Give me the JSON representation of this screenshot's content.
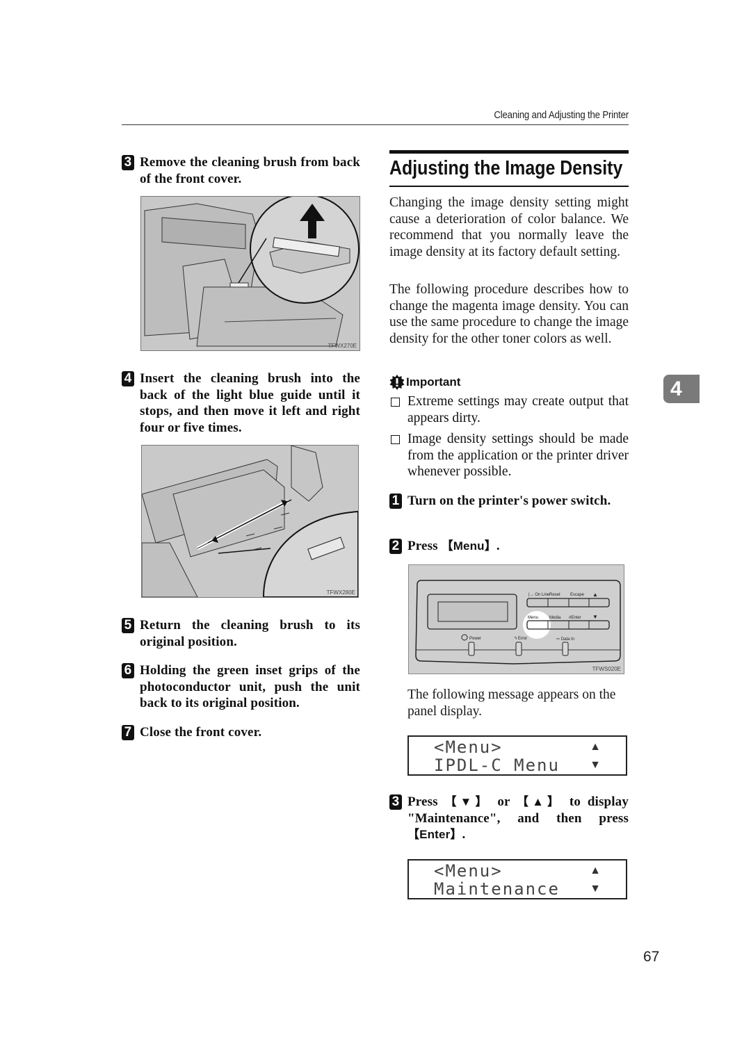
{
  "header": {
    "running_head": "Cleaning and Adjusting the Printer"
  },
  "left_column": {
    "steps": [
      {
        "number": "3",
        "text": "Remove the cleaning brush from back of the front cover."
      },
      {
        "number": "4",
        "text": "Insert the cleaning brush into the back of the light blue guide until it stops, and then move it left and right four or five times."
      },
      {
        "number": "5",
        "text": "Return the cleaning brush to its original position."
      },
      {
        "number": "6",
        "text": "Holding the green inset grips of the photoconductor unit, push the unit back to its original position."
      },
      {
        "number": "7",
        "text": "Close the front cover."
      }
    ],
    "figures": [
      {
        "code": "TFWX270E",
        "description": "printer-front-cover-brush-removal-illustration"
      },
      {
        "code": "TFWX280E",
        "description": "cleaning-brush-insertion-illustration"
      }
    ]
  },
  "right_column": {
    "section_title": "Adjusting the Image Density",
    "intro_paragraphs": [
      "Changing the image density setting might cause a deterioration of color balance. We recommend that you normally leave the image density at its factory default setting.",
      "The following procedure describes how to change the magenta image density. You can use the same procedure to change the image density for the other toner colors as well."
    ],
    "important": {
      "label": "Important",
      "icon": "important-icon",
      "items": [
        "Extreme settings may create output that appears dirty.",
        "Image density settings should be made from the application or the printer driver whenever possible."
      ]
    },
    "steps": [
      {
        "number": "1",
        "text": "Turn on the printer's power switch."
      },
      {
        "number": "2",
        "prefix": "Press ",
        "key": "【Menu】",
        "suffix": "."
      },
      {
        "number": "3",
        "text_a": "Press ",
        "key_a": "【▼】",
        "text_b": " or ",
        "key_b": "【▲】",
        "text_c": " to display \"Maintenance\", and then press ",
        "key_c": "【Enter】",
        "text_d": "."
      }
    ],
    "panel_figure": {
      "code": "TFWS020E",
      "buttons_top": [
        "On Line",
        "Reset",
        "Escape",
        "▲"
      ],
      "buttons_bottom": [
        "Menu",
        "Media",
        "#Enter",
        "▼"
      ],
      "indicators": [
        "Power",
        "Error",
        "Data In"
      ],
      "highlighted_button": "Menu"
    },
    "after_panel_text": "The following message appears on the panel display.",
    "lcd_displays": [
      {
        "line1": "<Menu>",
        "line2": "IPDL-C Menu",
        "arrow_up": "▲",
        "arrow_down": "▼"
      },
      {
        "line1": "<Menu>",
        "line2": "Maintenance",
        "arrow_up": "▲",
        "arrow_down": "▼"
      }
    ]
  },
  "chapter_tab": "4",
  "page_number": "67"
}
